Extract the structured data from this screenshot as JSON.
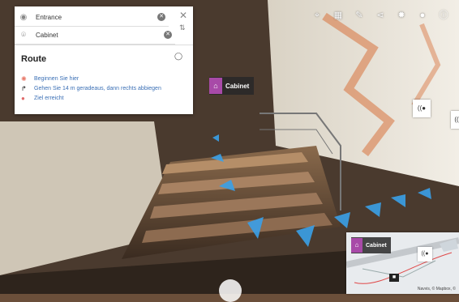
{
  "route_panel": {
    "from_value": "Entrance",
    "to_value": "Cabinet",
    "title": "Route",
    "steps": [
      "Beginnen Sie hier",
      "Gehen Sie 14 m geradeaus, dann rechts abbiegen",
      "Ziel erreicht"
    ]
  },
  "toolbar": {
    "icons": [
      "location-icon",
      "grid-icon",
      "wrench-icon",
      "share-icon",
      "settings-icon",
      "user-icon",
      "info-icon"
    ]
  },
  "poi": {
    "label": "Cabinet",
    "color": "#a84aa8"
  },
  "minimap": {
    "poi_label": "Cabinet",
    "attribution": "Navvis, © Mapbox, ©"
  }
}
